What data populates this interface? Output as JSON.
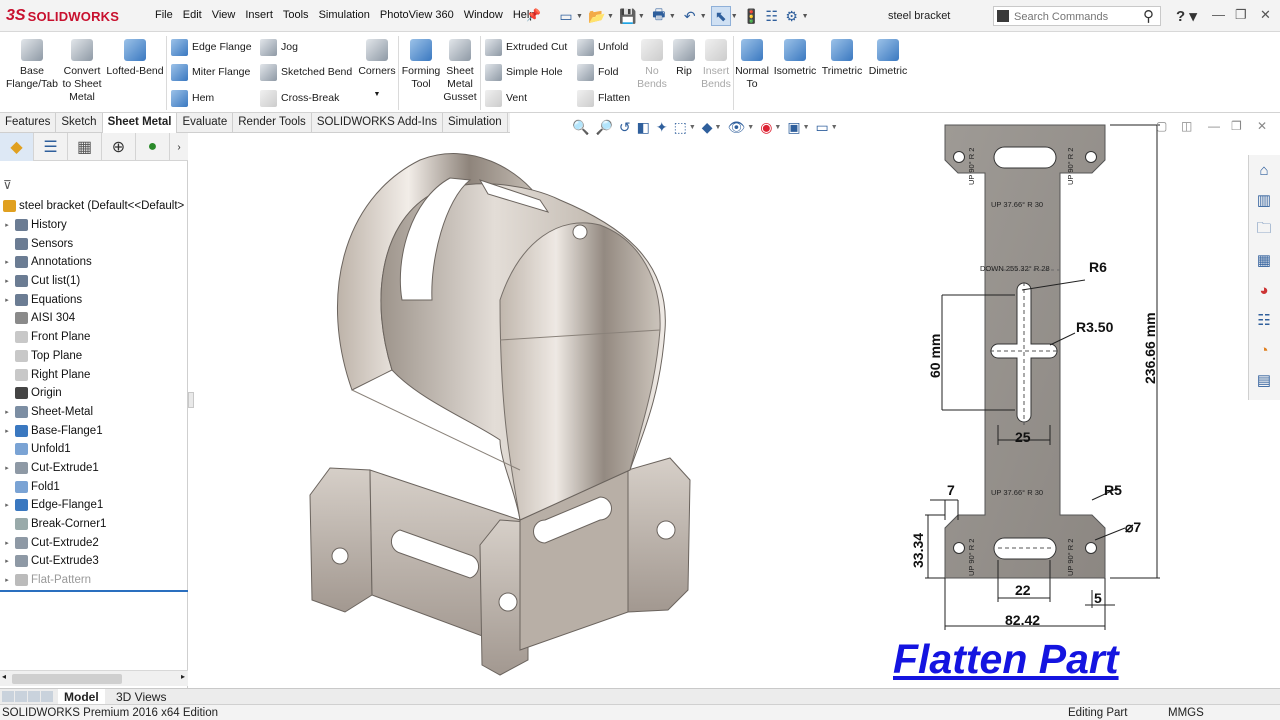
{
  "app": {
    "brand": "SOLIDWORKS",
    "brand_mark": "3S",
    "document_title": "steel bracket"
  },
  "menu": [
    "File",
    "Edit",
    "View",
    "Insert",
    "Tools",
    "Simulation",
    "PhotoView 360",
    "Window",
    "Help"
  ],
  "search": {
    "placeholder": "Search Commands"
  },
  "ribbon": {
    "base_flange": "Base\nFlange/Tab",
    "convert": "Convert\nto Sheet\nMetal",
    "lofted_bend": "Lofted-Bend",
    "edge_flange": "Edge Flange",
    "miter_flange": "Miter Flange",
    "hem": "Hem",
    "jog": "Jog",
    "sketched_bend": "Sketched Bend",
    "cross_break": "Cross-Break",
    "corners": "Corners",
    "forming_tool": "Forming\nTool",
    "sheet_metal_gusset": "Sheet\nMetal\nGusset",
    "extruded_cut": "Extruded Cut",
    "simple_hole": "Simple Hole",
    "vent": "Vent",
    "unfold": "Unfold",
    "fold": "Fold",
    "flatten": "Flatten",
    "no_bends": "No\nBends",
    "rip": "Rip",
    "insert_bends": "Insert\nBends",
    "normal_to": "Normal\nTo",
    "isometric": "Isometric",
    "trimetric": "Trimetric",
    "dimetric": "Dimetric"
  },
  "tabs": [
    "Features",
    "Sketch",
    "Sheet Metal",
    "Evaluate",
    "Render Tools",
    "SOLIDWORKS Add-Ins",
    "Simulation"
  ],
  "active_tab": "Sheet Metal",
  "tree": {
    "root": "steel bracket  (Default<<Default>",
    "items": [
      {
        "label": "History",
        "icon": "history-icon",
        "expandable": true
      },
      {
        "label": "Sensors",
        "icon": "sensor-icon",
        "expandable": false
      },
      {
        "label": "Annotations",
        "icon": "annotation-icon",
        "expandable": true
      },
      {
        "label": "Cut list(1)",
        "icon": "cutlist-icon",
        "expandable": true
      },
      {
        "label": "Equations",
        "icon": "equation-icon",
        "expandable": true
      },
      {
        "label": "AISI 304",
        "icon": "material-icon",
        "expandable": false
      },
      {
        "label": "Front Plane",
        "icon": "plane-icon",
        "expandable": false
      },
      {
        "label": "Top Plane",
        "icon": "plane-icon",
        "expandable": false
      },
      {
        "label": "Right Plane",
        "icon": "plane-icon",
        "expandable": false
      },
      {
        "label": "Origin",
        "icon": "origin-icon",
        "expandable": false
      },
      {
        "label": "Sheet-Metal",
        "icon": "sheetmetal-icon",
        "expandable": true
      },
      {
        "label": "Base-Flange1",
        "icon": "base-flange-icon",
        "expandable": true
      },
      {
        "label": "Unfold1",
        "icon": "unfold-icon",
        "expandable": false
      },
      {
        "label": "Cut-Extrude1",
        "icon": "cut-extrude-icon",
        "expandable": true
      },
      {
        "label": "Fold1",
        "icon": "fold-icon",
        "expandable": false
      },
      {
        "label": "Edge-Flange1",
        "icon": "edge-flange-icon",
        "expandable": true
      },
      {
        "label": "Break-Corner1",
        "icon": "break-corner-icon",
        "expandable": false
      },
      {
        "label": "Cut-Extrude2",
        "icon": "cut-extrude-icon",
        "expandable": true
      },
      {
        "label": "Cut-Extrude3",
        "icon": "cut-extrude-icon",
        "expandable": true
      },
      {
        "label": "Flat-Pattern",
        "icon": "flat-pattern-icon",
        "expandable": true,
        "suppressed": true
      }
    ]
  },
  "bottom_tabs": [
    "Model",
    "3D Views"
  ],
  "status": {
    "edition": "SOLIDWORKS Premium 2016 x64 Edition",
    "mode": "Editing Part",
    "units": "MMGS"
  },
  "flat_pattern": {
    "bend_top_left": "UP  90°  R 2",
    "bend_top_right": "UP  90°  R 2",
    "bend_up_1": "UP  37.66°  R 30",
    "bend_down": "DOWN  255.32°  R 28",
    "bend_up_2": "UP  37.66°  R 30",
    "bend_bottom_left": "UP  90°  R 2",
    "bend_bottom_right": "UP  90°  R 2",
    "dim_r6": "R6",
    "dim_r350": "R3.50",
    "dim_60": "60 mm",
    "dim_236": "236.66 mm",
    "dim_25": "25",
    "dim_7": "7",
    "dim_r5": "R5",
    "dim_phi7": "⌀7",
    "dim_3334": "33.34",
    "dim_22": "22",
    "dim_5": "5",
    "dim_8242": "82.42"
  },
  "overlay_title": "Flatten Part"
}
